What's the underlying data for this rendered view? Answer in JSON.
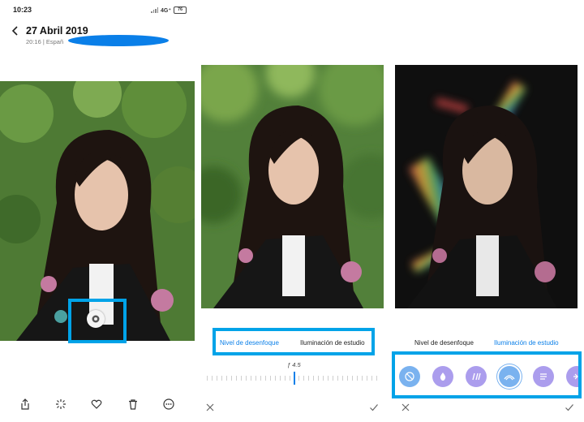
{
  "status_bar": {
    "time": "10:23",
    "network": "4G⁺",
    "battery": "76"
  },
  "header": {
    "date_title": "27 Abril 2019",
    "meta": "20:16 | Españ"
  },
  "editor": {
    "tab_blur": "Nivel de desenfoque",
    "tab_lighting": "Iluminación de estudio",
    "aperture": "ƒ 4.5",
    "blur_level_fraction": 0.5
  },
  "toolbar_icons": [
    "share-icon",
    "magic-wand-icon",
    "heart-icon",
    "trash-icon",
    "more-icon"
  ],
  "lighting_effects": [
    "none-effect-icon",
    "drop-effect-icon",
    "stripes-effect-icon",
    "rainbow-effect-icon",
    "lines-effect-icon",
    "partial-effect-icon"
  ],
  "colors": {
    "highlight": "#00a3e8",
    "active_tab": "#0a7fe8",
    "effect_blue": "#7ab2ef",
    "effect_purple": "#ab9ded"
  }
}
